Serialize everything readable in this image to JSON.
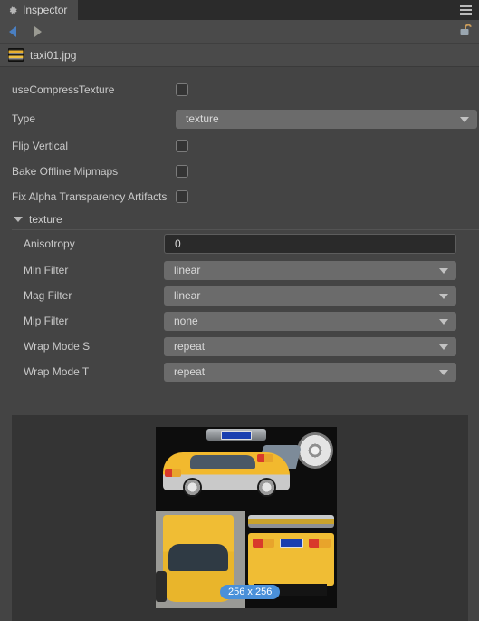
{
  "window": {
    "tab_label": "Inspector",
    "tab_icon": "gear-icon",
    "menu_icon": "hamburger-menu-icon",
    "lock_icon": "unlocked-padlock-icon"
  },
  "nav": {
    "back_icon": "back-arrow-icon",
    "forward_icon": "forward-arrow-icon"
  },
  "file": {
    "name": "taxi01.jpg",
    "icon": "image-file-thumbnail-icon"
  },
  "properties": [
    {
      "label": "useCompressTexture",
      "control": "checkbox",
      "value": false
    },
    {
      "label": "Type",
      "control": "dropdown",
      "value": "texture"
    },
    {
      "label": "Flip Vertical",
      "control": "checkbox",
      "value": false
    },
    {
      "label": "Bake Offline Mipmaps",
      "control": "checkbox",
      "value": false
    },
    {
      "label": "Fix Alpha Transparency Artifacts",
      "control": "checkbox",
      "value": false
    }
  ],
  "section": {
    "title": "texture",
    "expanded": true,
    "caret_icon": "caret-down-icon",
    "fields": [
      {
        "label": "Anisotropy",
        "control": "number-input",
        "value": "0"
      },
      {
        "label": "Min Filter",
        "control": "dropdown",
        "value": "linear"
      },
      {
        "label": "Mag Filter",
        "control": "dropdown",
        "value": "linear"
      },
      {
        "label": "Mip Filter",
        "control": "dropdown",
        "value": "none"
      },
      {
        "label": "Wrap Mode S",
        "control": "dropdown",
        "value": "repeat"
      },
      {
        "label": "Wrap Mode T",
        "control": "dropdown",
        "value": "repeat"
      }
    ]
  },
  "preview": {
    "size_badge": "256 x 256",
    "image_alt": "taxi texture atlas"
  },
  "colors": {
    "panel_bg": "#444444",
    "tabbar_bg": "#2b2b2b",
    "tab_active_bg": "#4a4a4a",
    "dropdown_bg": "#6b6b6b",
    "input_bg": "#2a2a2a",
    "preview_bg": "#343434",
    "badge_bg": "#4a90d9",
    "back_arrow": "#4a7fc1",
    "forward_arrow": "#9a9a92"
  }
}
